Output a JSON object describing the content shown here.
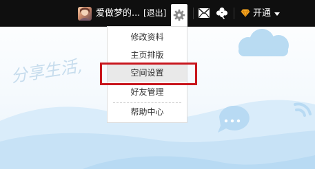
{
  "topbar": {
    "username": "爱做梦的...",
    "logout_label": "[退出]",
    "icons": [
      "gear-icon",
      "mail-icon",
      "clover-icon",
      "diamond-icon",
      "chevron-down-icon"
    ],
    "vip_label": "开通"
  },
  "dropdown": {
    "items": [
      {
        "label": "修改资料"
      },
      {
        "label": "主页排版"
      },
      {
        "label": "空间设置",
        "highlighted": true
      },
      {
        "label": "好友管理"
      },
      {
        "label": "帮助中心"
      }
    ]
  },
  "background": {
    "watermark": "分享生活,"
  },
  "colors": {
    "topbar": "#0f0f0f",
    "highlight_border": "#c8161d",
    "vip_gem": "#f5a623",
    "sky": "#dbeefb"
  }
}
